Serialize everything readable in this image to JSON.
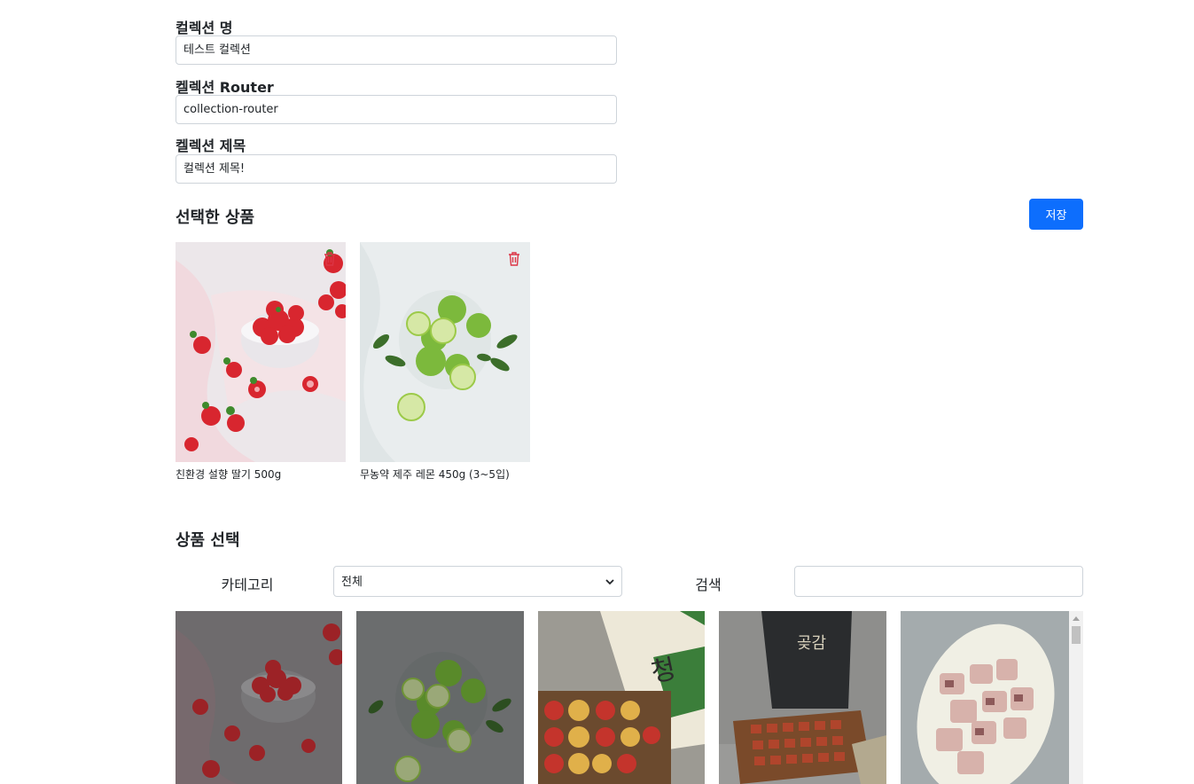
{
  "form": {
    "collection_name_label": "컬렉션 명",
    "collection_name_value": "테스트 컬렉션",
    "collection_router_label": "켈렉션 Router",
    "collection_router_value": "collection-router",
    "collection_title_label": "켈렉션 제목",
    "collection_title_value": "컬렉션 제목!"
  },
  "selected": {
    "title": "선택한 상품",
    "save_label": "저장",
    "items": [
      {
        "name": "친환경 설향 딸기 500g",
        "image": "strawberry"
      },
      {
        "name": "무농약 제주 레몬 450g (3~5입)",
        "image": "lime"
      }
    ]
  },
  "picker": {
    "title": "상품 선택",
    "category_label": "카테고리",
    "category_selected": "전체",
    "search_label": "검색",
    "search_value": "",
    "products": [
      "strawberry",
      "lime",
      "fruit-gift-box",
      "persimmon-gift-box",
      "fish-plate"
    ]
  },
  "colors": {
    "primary": "#0d6efd",
    "trash_icon": "#dc3545",
    "border": "#ced4da"
  }
}
